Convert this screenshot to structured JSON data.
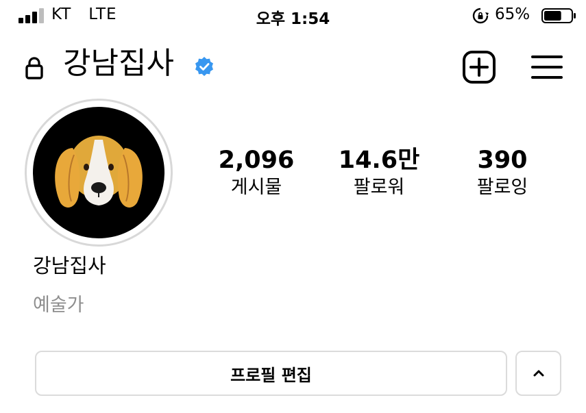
{
  "status_bar": {
    "carrier": "KT",
    "network": "LTE",
    "time": "오후 1:54",
    "battery": "65%",
    "battery_level": 0.65,
    "icons": [
      "signal-icon",
      "rotation-lock-icon",
      "battery-icon"
    ]
  },
  "header": {
    "username": "강남집사",
    "verified": true,
    "icons": [
      "lock-icon",
      "verified-badge-icon",
      "add-post-icon",
      "menu-icon"
    ]
  },
  "profile": {
    "avatar": "beagle-avatar",
    "stats": [
      {
        "value": "2,096",
        "label": "게시물"
      },
      {
        "value": "14.6만",
        "label": "팔로워"
      },
      {
        "value": "390",
        "label": "팔로잉"
      }
    ],
    "display_name": "강남집사",
    "category": "예술가"
  },
  "actions": {
    "edit_profile": "프로필 편집",
    "collapse_icon": "chevron-up-icon"
  },
  "colors": {
    "verified_blue": "#3897f0",
    "secondary_text": "#8e8e8e",
    "border": "#dbdbdb",
    "dog_tan": "#e0a83a"
  }
}
